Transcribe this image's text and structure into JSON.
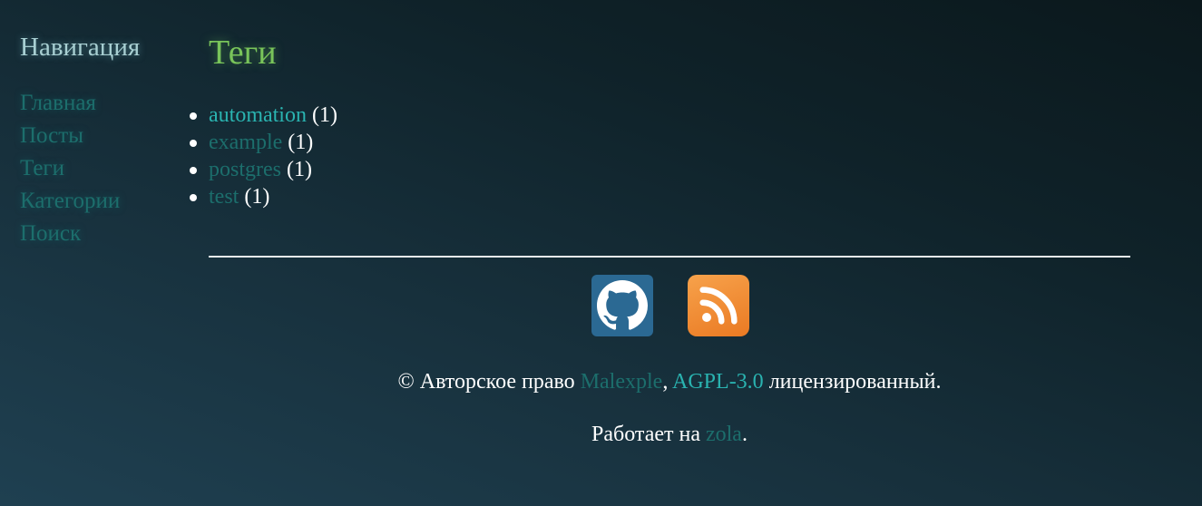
{
  "nav": {
    "title": "Навигация",
    "items": [
      {
        "label": "Главная"
      },
      {
        "label": "Посты"
      },
      {
        "label": "Теги"
      },
      {
        "label": "Категории"
      },
      {
        "label": "Поиск"
      }
    ]
  },
  "page": {
    "title": "Теги"
  },
  "tags": [
    {
      "name": "automation",
      "count": "(1)"
    },
    {
      "name": "example",
      "count": "(1)"
    },
    {
      "name": "postgres",
      "count": "(1)"
    },
    {
      "name": "test",
      "count": "(1)"
    }
  ],
  "footer": {
    "social": [
      {
        "icon": "github-icon",
        "color": "#2b6993"
      },
      {
        "icon": "rss-icon",
        "color": "#f0882f"
      }
    ],
    "copyright_symbol": "©",
    "copyright_text": "Авторское право",
    "author": "Malexple",
    "comma": ",",
    "license": "AGPL-3.0",
    "license_suffix": "лицензированный",
    "period": ".",
    "powered_text": "Работает на",
    "engine": "zola",
    "powered_period": "."
  },
  "colors": {
    "link": "#1c6e6c",
    "link_active": "#2ab3b0",
    "title": "#79c45a",
    "nav_title": "#a8cfd2"
  }
}
